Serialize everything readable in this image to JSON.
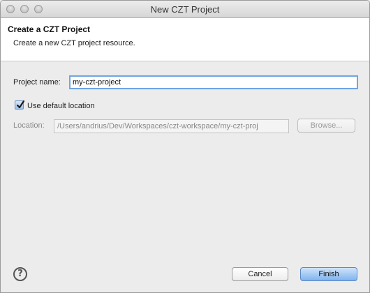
{
  "window": {
    "title": "New CZT Project"
  },
  "banner": {
    "title": "Create a CZT Project",
    "description": "Create a new CZT project resource."
  },
  "form": {
    "project_name_label": "Project name:",
    "project_name_value": "my-czt-project",
    "use_default_label": "Use default location",
    "use_default_checked": true,
    "location_label": "Location:",
    "location_value": "/Users/andrius/Dev/Workspaces/czt-workspace/my-czt-proj",
    "browse_label": "Browse..."
  },
  "footer": {
    "help_glyph": "?",
    "cancel_label": "Cancel",
    "finish_label": "Finish"
  },
  "icons": {
    "help": "help-icon",
    "checkmark": "checkmark-icon"
  },
  "colors": {
    "default_button": "#7fb3ee",
    "focus_ring": "#6ea5e6"
  }
}
